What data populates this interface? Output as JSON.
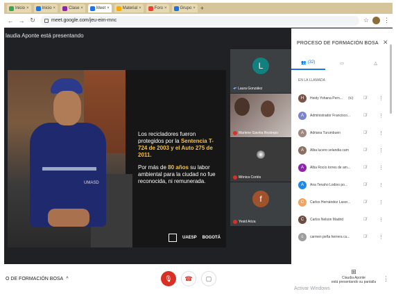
{
  "browser": {
    "tabs": [
      {
        "label": "Inicio",
        "color": "#34a853"
      },
      {
        "label": "Inicio",
        "color": "#1a73e8"
      },
      {
        "label": "Clase",
        "color": "#8e24aa"
      },
      {
        "label": "Meet",
        "color": "#1a73e8"
      },
      {
        "label": "Material",
        "color": "#f9ab00"
      },
      {
        "label": "Foro",
        "color": "#ea4335"
      },
      {
        "label": "Grupo",
        "color": "#1a73e8"
      }
    ],
    "new_tab": "+",
    "url": "meet.google.com/jeu-eim-mnc"
  },
  "meet": {
    "presenting_label": "laudia Aponte está presentando",
    "slide": {
      "photo_tag": "UMASD",
      "paragraph1_pre": "Los recicladores fueron protegidos por la ",
      "paragraph1_hl": "Sentencia T-724 de 2003 y el Auto 275 de 2011.",
      "paragraph2_pre": "Por más de ",
      "paragraph2_hl": "80 años",
      "paragraph2_post": " su labor ambiental para la ciudad no fue reconocida, ni remunerada.",
      "logo1": "UAESP",
      "logo2": "BOGOTÁ"
    },
    "tiles": [
      {
        "name": "Laura González",
        "initial": "L",
        "color": "#12807f"
      },
      {
        "name": "Marlene Gaviria Restrepo",
        "initial": "",
        "color": ""
      },
      {
        "name": "Mónica Cortés",
        "initial": "",
        "color": ""
      },
      {
        "name": "Yesid Ariza",
        "initial": "f",
        "color": "#a0522d"
      }
    ]
  },
  "bottom": {
    "meeting_title": "O DE FORMACIÓN BOSA",
    "chevron": "^",
    "present_name": "Claudia Aponte",
    "present_sub": "está presentando su pantalla",
    "watermark": "Activar Windows"
  },
  "panel": {
    "title": "PROCESO DE FORMACIÓN BOSA",
    "people_count": "(32)",
    "in_call": "EN LA LLAMADA",
    "participants": [
      {
        "name": "Heidy Yohana Pern...",
        "initial": "H",
        "color": "#795548",
        "suffix": "(tú)"
      },
      {
        "name": "Administrador Francisco...",
        "initial": "A",
        "color": "#7986cb",
        "suffix": ""
      },
      {
        "name": "Adriana Turumbuen",
        "initial": "A",
        "color": "#a1887f",
        "suffix": ""
      },
      {
        "name": "Alba lucero velandia cam",
        "initial": "A",
        "color": "#8d6e63",
        "suffix": ""
      },
      {
        "name": "Alba Rocío torres de am...",
        "initial": "A",
        "color": "#8e24aa",
        "suffix": ""
      },
      {
        "name": "Ana Tenaho Lodino po...",
        "initial": "A",
        "color": "#1e88e5",
        "suffix": ""
      },
      {
        "name": "Carlos Hernández Lasor...",
        "initial": "C",
        "color": "#f0a45d",
        "suffix": ""
      },
      {
        "name": "Carlos Nelson Madrid",
        "initial": "C",
        "color": "#6d4c41",
        "suffix": ""
      },
      {
        "name": "carmen peña herrera cu...",
        "initial": "c",
        "color": "#9e9e9e",
        "suffix": ""
      }
    ]
  }
}
